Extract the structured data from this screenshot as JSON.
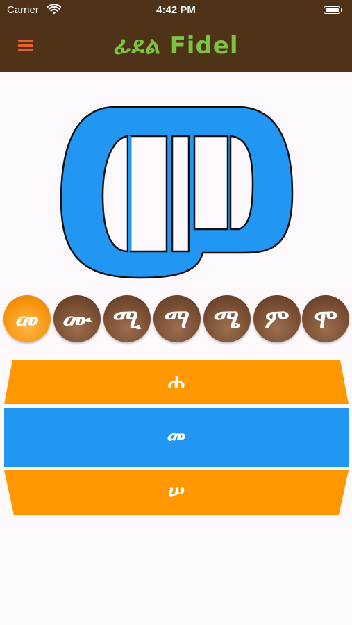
{
  "status_bar": {
    "carrier": "Carrier",
    "time": "4:42 PM"
  },
  "nav": {
    "title": "ፊደል Fidel",
    "menu_icon": "hamburger-menu-icon",
    "title_color": "#7cc440",
    "bar_color": "#4e3318"
  },
  "main_letter": {
    "character": "መ",
    "fill_color": "#2196f3"
  },
  "variants": [
    {
      "label": "መ",
      "selected": true
    },
    {
      "label": "ሙ",
      "selected": false
    },
    {
      "label": "ሚ",
      "selected": false
    },
    {
      "label": "ማ",
      "selected": false
    },
    {
      "label": "ሜ",
      "selected": false
    },
    {
      "label": "ም",
      "selected": false
    },
    {
      "label": "ሞ",
      "selected": false
    }
  ],
  "picker": {
    "previous": "ሐ",
    "current": "መ",
    "next": "ሠ",
    "colors": {
      "orange": "#ff9800",
      "blue": "#2196f3"
    }
  }
}
